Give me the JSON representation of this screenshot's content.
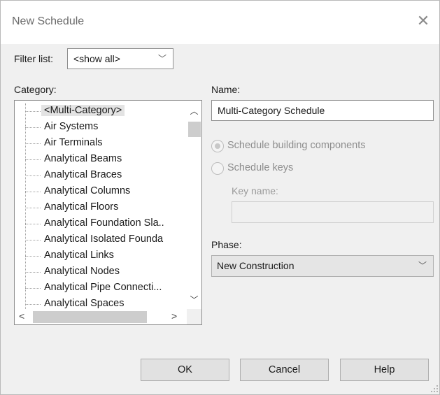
{
  "window": {
    "title": "New Schedule"
  },
  "filter": {
    "label": "Filter list:",
    "value": "<show all>"
  },
  "category": {
    "label": "Category:",
    "items": [
      "<Multi-Category>",
      "Air Systems",
      "Air Terminals",
      "Analytical Beams",
      "Analytical Braces",
      "Analytical Columns",
      "Analytical Floors",
      "Analytical Foundation Sla..",
      "Analytical Isolated Founda",
      "Analytical Links",
      "Analytical Nodes",
      "Analytical Pipe Connecti...",
      "Analytical Spaces"
    ],
    "selected_index": 0
  },
  "name": {
    "label": "Name:",
    "value": "Multi-Category Schedule"
  },
  "options": {
    "building_components_label": "Schedule building components",
    "schedule_keys_label": "Schedule keys",
    "key_name_label": "Key name:",
    "key_name_value": ""
  },
  "phase": {
    "label": "Phase:",
    "value": "New Construction"
  },
  "buttons": {
    "ok": "OK",
    "cancel": "Cancel",
    "help": "Help"
  },
  "icons": {
    "close": "close-icon",
    "dropdown": "chevron-down-icon",
    "scroll_up": "chevron-up-icon",
    "scroll_down": "chevron-down-icon",
    "scroll_left": "chevron-left-icon",
    "scroll_right": "chevron-right-icon",
    "resize": "resize-grip-icon"
  }
}
